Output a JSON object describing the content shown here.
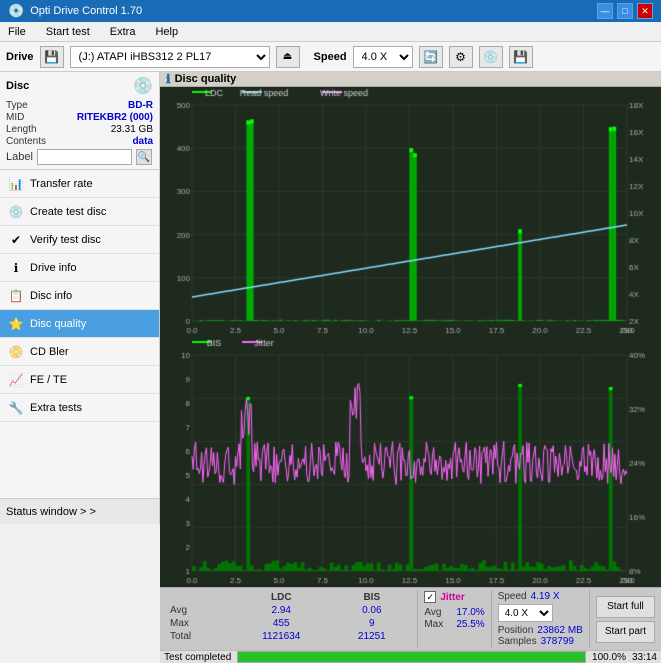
{
  "window": {
    "title": "Opti Drive Control 1.70",
    "controls": [
      "—",
      "□",
      "✕"
    ]
  },
  "menu": {
    "items": [
      "File",
      "Start test",
      "Extra",
      "Help"
    ]
  },
  "toolbar": {
    "drive_label": "Drive",
    "drive_value": "(J:)  ATAPI iHBS312  2 PL17",
    "speed_label": "Speed",
    "speed_value": "4.0 X"
  },
  "disc": {
    "section_title": "Disc",
    "type_label": "Type",
    "type_value": "BD-R",
    "mid_label": "MID",
    "mid_value": "RITEKBR2 (000)",
    "length_label": "Length",
    "length_value": "23.31 GB",
    "contents_label": "Contents",
    "contents_value": "data",
    "label_label": "Label"
  },
  "nav": {
    "items": [
      {
        "id": "transfer-rate",
        "label": "Transfer rate",
        "icon": "📊"
      },
      {
        "id": "create-test-disc",
        "label": "Create test disc",
        "icon": "💿"
      },
      {
        "id": "verify-test-disc",
        "label": "Verify test disc",
        "icon": "✔"
      },
      {
        "id": "drive-info",
        "label": "Drive info",
        "icon": "ℹ"
      },
      {
        "id": "disc-info",
        "label": "Disc info",
        "icon": "📋"
      },
      {
        "id": "disc-quality",
        "label": "Disc quality",
        "icon": "⭐",
        "active": true
      },
      {
        "id": "cd-bler",
        "label": "CD Bler",
        "icon": "📀"
      },
      {
        "id": "fe-te",
        "label": "FE / TE",
        "icon": "📈"
      },
      {
        "id": "extra-tests",
        "label": "Extra tests",
        "icon": "🔧"
      }
    ]
  },
  "status_window": "Status window > >",
  "disc_quality": {
    "title": "Disc quality",
    "legend_upper": [
      {
        "label": "LDC",
        "color": "#00ff00"
      },
      {
        "label": "Read speed",
        "color": "#00ccff"
      },
      {
        "label": "Write speed",
        "color": "#ff66ff"
      }
    ],
    "legend_lower": [
      {
        "label": "BIS",
        "color": "#00ff00"
      },
      {
        "label": "Jitter",
        "color": "#ff66ff"
      }
    ]
  },
  "stats": {
    "columns": [
      "LDC",
      "BIS"
    ],
    "rows": [
      {
        "label": "Avg",
        "ldc": "2.94",
        "bis": "0.06"
      },
      {
        "label": "Max",
        "ldc": "455",
        "bis": "9"
      },
      {
        "label": "Total",
        "ldc": "1121634",
        "bis": "21251"
      }
    ],
    "jitter": {
      "label": "Jitter",
      "avg": "17.0%",
      "max": "25.5%"
    },
    "speed": {
      "label": "Speed",
      "value": "4.19 X",
      "select": "4.0 X"
    },
    "position": {
      "label": "Position",
      "value": "23862 MB"
    },
    "samples": {
      "label": "Samples",
      "value": "378799"
    },
    "buttons": {
      "start_full": "Start full",
      "start_part": "Start part"
    }
  },
  "progress": {
    "percent": 100,
    "text": "100.0%",
    "status": "Test completed",
    "time": "33:14"
  },
  "colors": {
    "accent": "#1a6bb5",
    "active_nav": "#4a9fe0",
    "chart_bg": "#1e2a1e",
    "ldc_color": "#00ff00",
    "read_speed_color": "#88ddff",
    "write_speed_color": "#ff88ff",
    "bis_color": "#00ff00",
    "jitter_color": "#ff66ff",
    "spike_color": "#00ff00"
  }
}
